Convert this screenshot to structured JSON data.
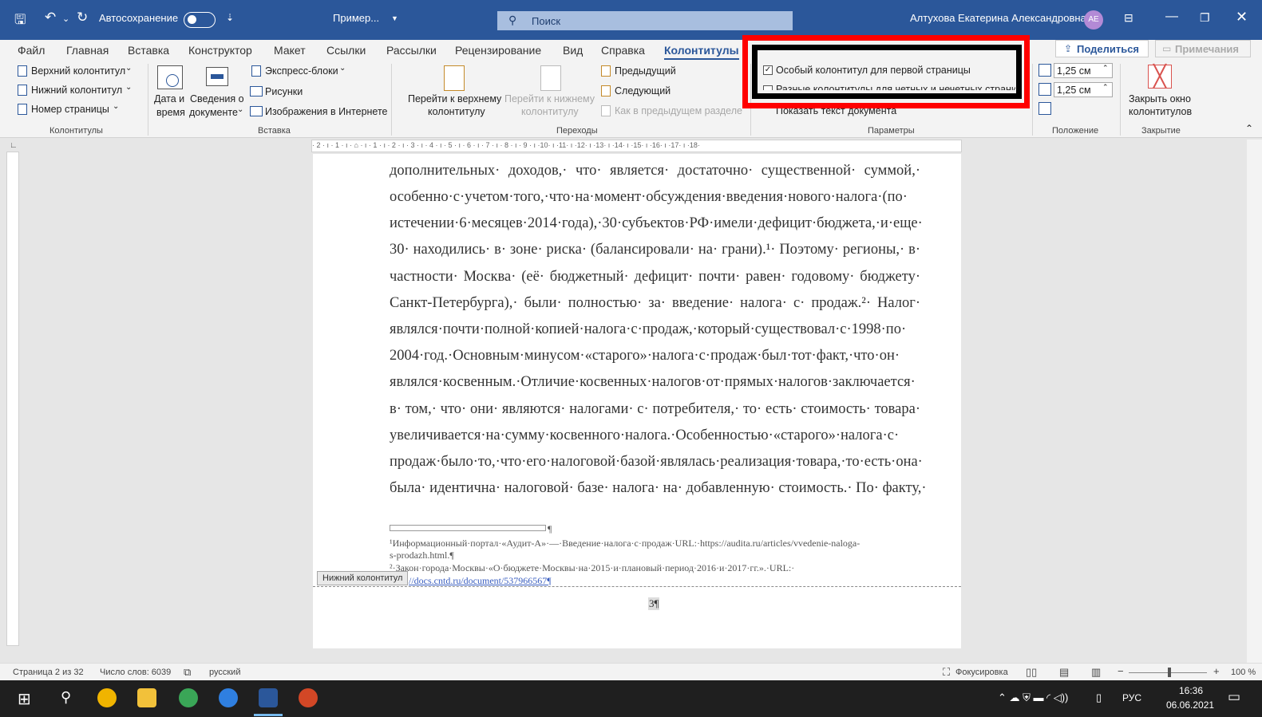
{
  "titlebar": {
    "autosave_label": "Автосохранение",
    "doc_name": "Пример...",
    "search_placeholder": "Поиск",
    "user_name": "Алтухова Екатерина Александровна",
    "avatar_initials": "АЕ"
  },
  "tabs": [
    "Файл",
    "Главная",
    "Вставка",
    "Конструктор",
    "Макет",
    "Ссылки",
    "Рассылки",
    "Рецензирование",
    "Вид",
    "Справка",
    "Колонтитулы"
  ],
  "share_label": "Поделиться",
  "comments_label": "Примечания",
  "ribbon": {
    "header": "Верхний колонтитул",
    "footer": "Нижний колонтитул",
    "page_number": "Номер страницы",
    "group_headers": "Колонтитулы",
    "date_time_1": "Дата и",
    "date_time_2": "время",
    "doc_info_1": "Сведения о",
    "doc_info_2": "документе",
    "quick_parts": "Экспресс-блоки",
    "pictures": "Рисунки",
    "online_pictures": "Изображения в Интернете",
    "group_insert": "Вставка",
    "goto_header_1": "Перейти к верхнему",
    "goto_header_2": "колонтитулу",
    "goto_footer_1": "Перейти к нижнему",
    "goto_footer_2": "колонтитулу",
    "previous": "Предыдущий",
    "next": "Следующий",
    "link_previous": "Как в предыдущем разделе",
    "group_nav": "Переходы",
    "opt_first_page": "Особый колонтитул для первой страницы",
    "opt_odd_even": "Разные колонтитулы для четных и нечетных страниц",
    "opt_show_text": "Показать текст документа",
    "group_options": "Параметры",
    "header_pos": "1,25 см",
    "footer_pos": "1,25 см",
    "group_position": "Положение",
    "close_1": "Закрыть окно",
    "close_2": "колонтитулов",
    "group_close": "Закрытие"
  },
  "ruler_text": "· 2 · ı · 1 · ı · ⌂ · ı · 1 · ı · 2 · ı · 3 · ı · 4 · ı · 5 · ı · 6 · ı · 7 · ı · 8 · ı · 9 · ı ·10· ı ·11· ı ·12· ı ·13· ı ·14· ı ·15· ı ·16· ı ·17· ı ·18·",
  "body_lines": [
    "дополнительных· доходов,· что· является· достаточно· существенной· суммой,·",
    "особенно·с·учетом·того,·что·на·момент·обсуждения·введения·нового·налога·(по·",
    "истечении·6·месяцев·2014·года),·30·субъектов·РФ·имели·дефицит·бюджета,·и·еще·",
    "30· находились· в· зоне· риска· (балансировали· на· грани).¹· Поэтому· регионы,· в·",
    "частности· Москва· (её· бюджетный· дефицит· почти· равен· годовому· бюджету·",
    "Санкт-Петербурга),· были· полностью· за· введение· налога· с· продаж.²· Налог·",
    "являлся·почти·полной·копией·налога·с·продаж,·который·существовал·с·1998·по·",
    "2004·год.·Основным·минусом·«старого»·налога·с·продаж·был·тот·факт,·что·он·",
    "являлся·косвенным.·Отличие·косвенных·налогов·от·прямых·налогов·заключается·",
    "в· том,· что· они· являются· налогами· с· потребителя,· то· есть· стоимость· товара·",
    "увеличивается·на·сумму·косвенного·налога.·Особенностью·«старого»·налога·с·",
    "продаж·было·то,·что·его·налоговой·базой·являлась·реализация·товара,·то·есть·она·",
    "была· идентична· налоговой· базе· налога· на· добавленную· стоимость.· По· факту,·"
  ],
  "footnotes": {
    "sep_mark": "¶",
    "fn1_a": "¹Информационный·портал·«Аудит-А»·—·Введение·налога·с·продаж·URL:·https://audita.ru/articles/vvedenie-naloga-",
    "fn1_b": "s-prodazh.html.¶",
    "fn2_a": "²·Закон·города·Москвы·«О·бюджете·Москвы·на·2015·и·плановый·период·2016·и·2017·гг.».·URL:·",
    "fn2_b": "//docs.cntd.ru/document/537966567¶"
  },
  "footer_tag": "Нижний колонтитул",
  "page_number_text": "3¶",
  "status": {
    "page": "Страница 2 из 32",
    "words": "Число слов: 6039",
    "language": "русский",
    "focus": "Фокусировка",
    "zoom": "100 %"
  },
  "taskbar": {
    "lang": "РУС",
    "time": "16:36",
    "date": "06.06.2021"
  },
  "colors": {
    "word_blue": "#2b579a",
    "highlight_red": "#ff0000"
  }
}
